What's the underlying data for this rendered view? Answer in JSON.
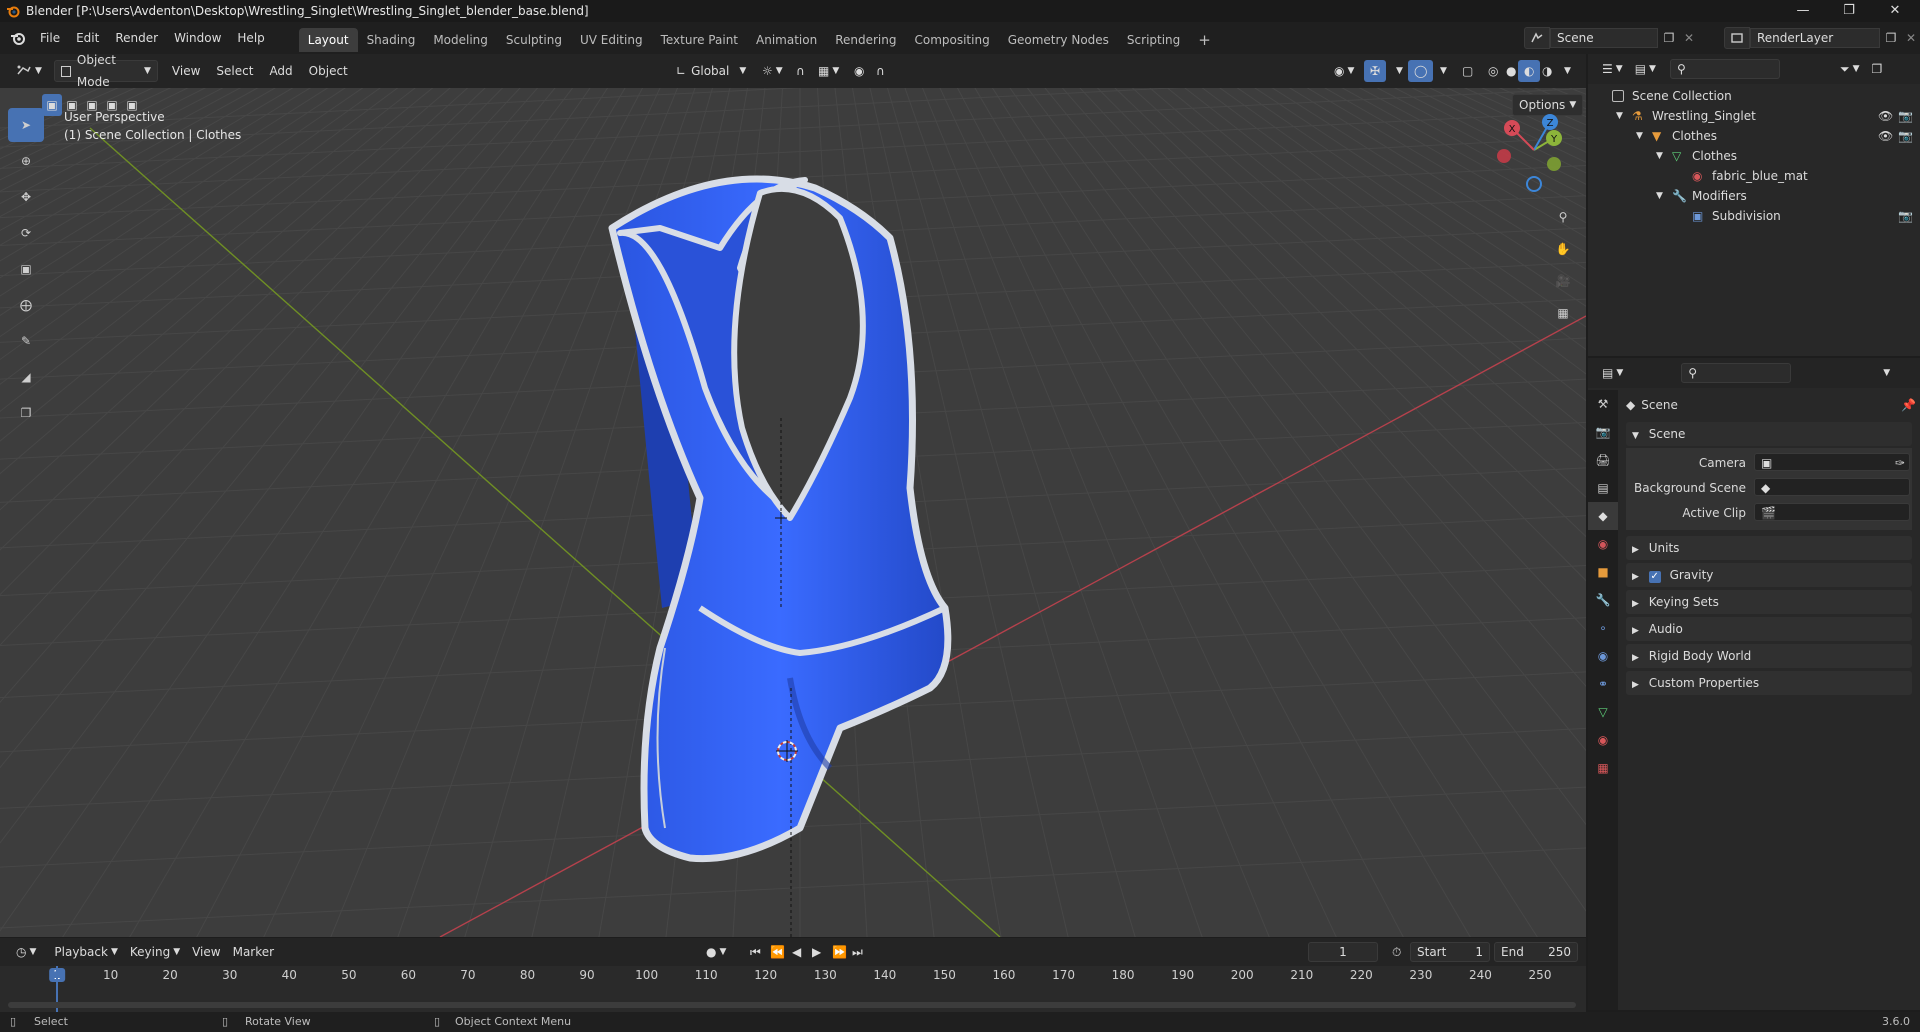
{
  "window": {
    "title": "Blender [P:\\Users\\Avdenton\\Desktop\\Wrestling_Singlet\\Wrestling_Singlet_blender_base.blend]"
  },
  "menu": {
    "items": [
      "File",
      "Edit",
      "Render",
      "Window",
      "Help"
    ]
  },
  "workspaces": [
    "Layout",
    "Shading",
    "Modeling",
    "Sculpting",
    "UV Editing",
    "Texture Paint",
    "Animation",
    "Rendering",
    "Compositing",
    "Geometry Nodes",
    "Scripting"
  ],
  "scene_selector": {
    "scene": "Scene",
    "view_layer": "RenderLayer"
  },
  "viewport_header": {
    "mode": "Object Mode",
    "view": "View",
    "select": "Select",
    "add": "Add",
    "object": "Object",
    "orientation": "Global",
    "options": "Options"
  },
  "viewport": {
    "perspective": "User Perspective",
    "collection_info": "(1) Scene Collection | Clothes"
  },
  "gizmo": {
    "x": "X",
    "y": "Y",
    "z": "Z"
  },
  "outliner": {
    "rows": [
      {
        "label": "Scene Collection"
      },
      {
        "label": "Wrestling_Singlet"
      },
      {
        "label": "Clothes"
      },
      {
        "label": "Clothes"
      },
      {
        "label": "fabric_blue_mat"
      },
      {
        "label": "Modifiers"
      },
      {
        "label": "Subdivision"
      }
    ]
  },
  "properties": {
    "context": "Scene",
    "panel_title": "Scene",
    "fields": [
      {
        "label": "Camera"
      },
      {
        "label": "Background Scene"
      },
      {
        "label": "Active Clip"
      }
    ],
    "panels": [
      "Units",
      "Gravity",
      "Keying Sets",
      "Audio",
      "Rigid Body World",
      "Custom Properties"
    ],
    "gravity_checked": true
  },
  "timeline": {
    "playback": "Playback",
    "keying": "Keying",
    "view": "View",
    "marker": "Marker",
    "current_frame": "1",
    "start_label": "Start",
    "start": "1",
    "end_label": "End",
    "end": "250",
    "ticks": [
      "1",
      "10",
      "20",
      "30",
      "40",
      "50",
      "60",
      "70",
      "80",
      "90",
      "100",
      "110",
      "120",
      "130",
      "140",
      "150",
      "160",
      "170",
      "180",
      "190",
      "200",
      "210",
      "220",
      "230",
      "240",
      "250"
    ]
  },
  "status": {
    "select": "Select",
    "rotate": "Rotate View",
    "context_menu": "Object Context Menu",
    "version": "3.6.0"
  },
  "colors": {
    "accent": "#4772b3",
    "singlet": "#2f5ff0",
    "trim": "#d8dde6",
    "x_axis": "#c0404a",
    "y_axis": "#7a9a2a"
  }
}
